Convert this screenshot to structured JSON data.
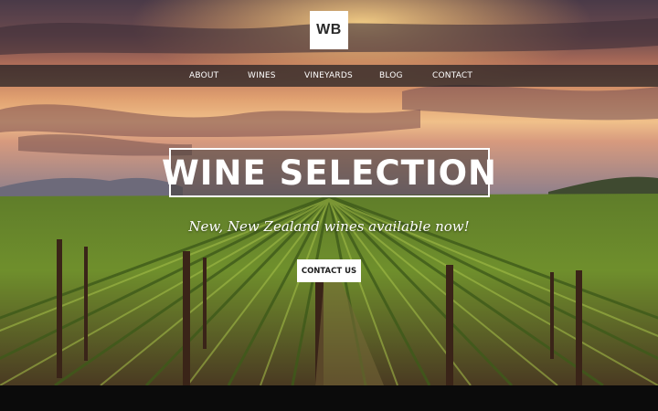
{
  "logo": {
    "text": "WB"
  },
  "nav": {
    "items": [
      {
        "label": "ABOUT"
      },
      {
        "label": "WINES"
      },
      {
        "label": "VINEYARDS"
      },
      {
        "label": "BLOG"
      },
      {
        "label": "CONTACT"
      }
    ]
  },
  "hero": {
    "title": "WINE SELECTION",
    "tagline": "New, New Zealand wines available now!",
    "cta_label": "CONTACT US"
  },
  "colors": {
    "nav_background": "#1e1e22",
    "button_background": "#ffffff",
    "footer_background": "#0b0b0b"
  }
}
